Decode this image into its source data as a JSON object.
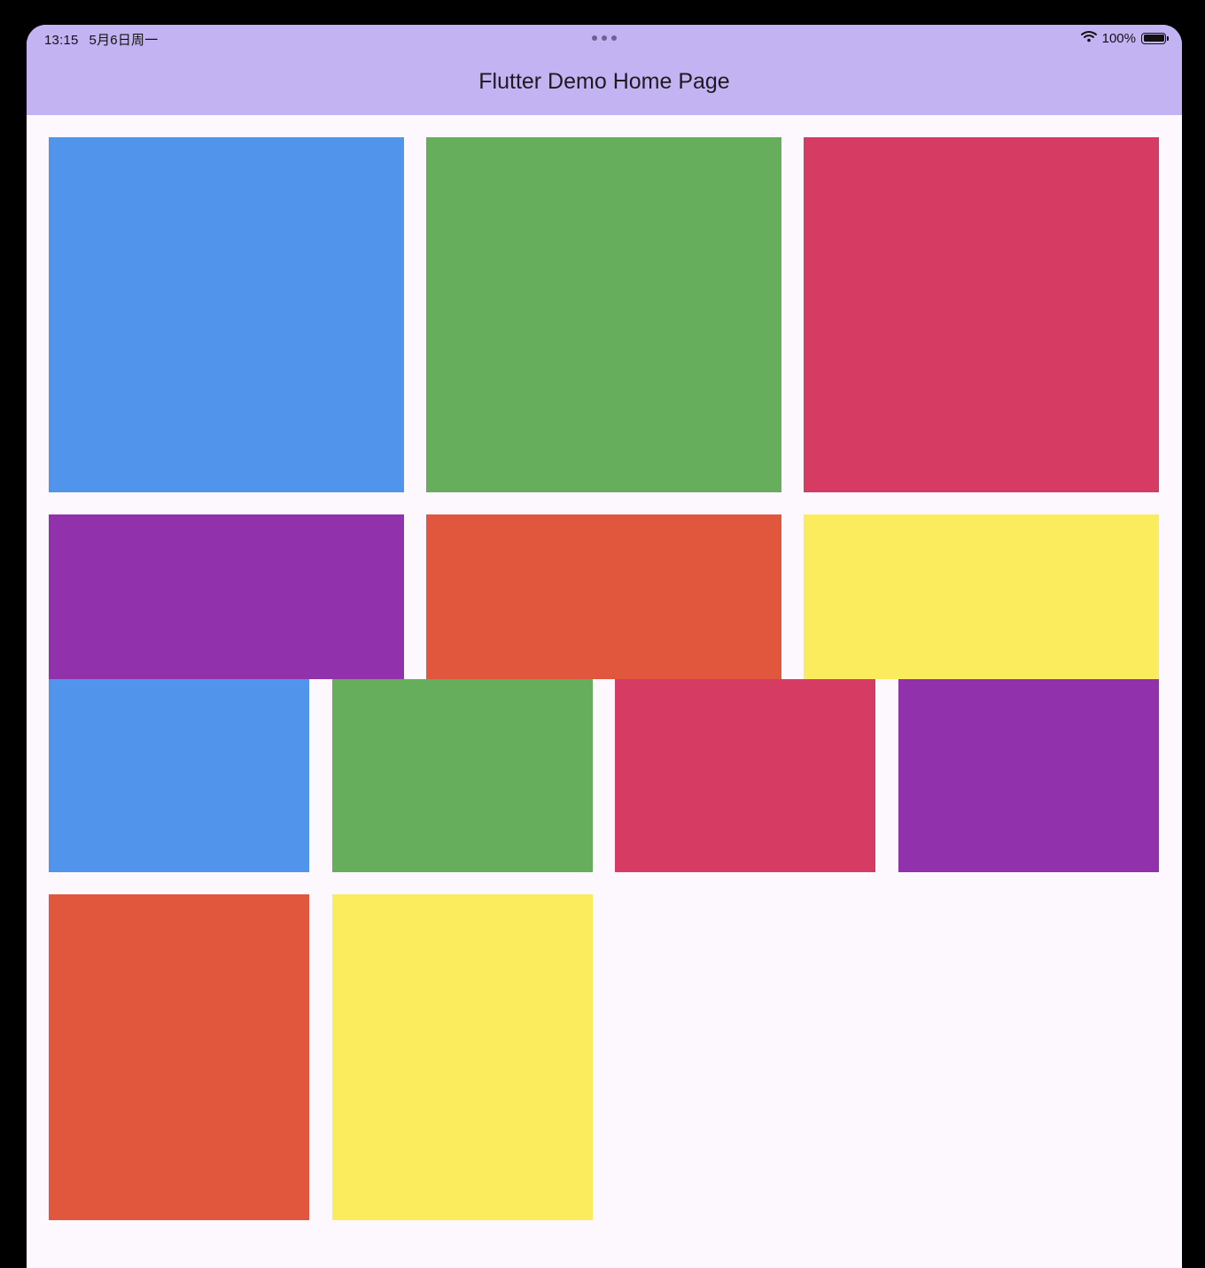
{
  "status_bar": {
    "time": "13:15",
    "date": "5月6日周一",
    "battery_text": "100%",
    "battery_level": 1.0,
    "icons": [
      "wifi-icon",
      "battery-icon",
      "multitasking-dots-icon"
    ]
  },
  "app_bar": {
    "title": "Flutter Demo Home Page",
    "background_color": "#c4b3f3"
  },
  "palette": {
    "blue": "#5194eb",
    "green": "#67ae5c",
    "crimson": "#d63b63",
    "purple": "#9131ab",
    "orange": "#e0573e",
    "yellow": "#faec5d",
    "background": "#fcf8fd"
  },
  "grid_top": {
    "columns": 3,
    "tiles": [
      "blue",
      "green",
      "crimson",
      "purple",
      "orange",
      "yellow"
    ]
  },
  "grid_bottom": {
    "columns": 4,
    "tiles": [
      "blue",
      "green",
      "crimson",
      "purple",
      "orange",
      "yellow"
    ]
  }
}
